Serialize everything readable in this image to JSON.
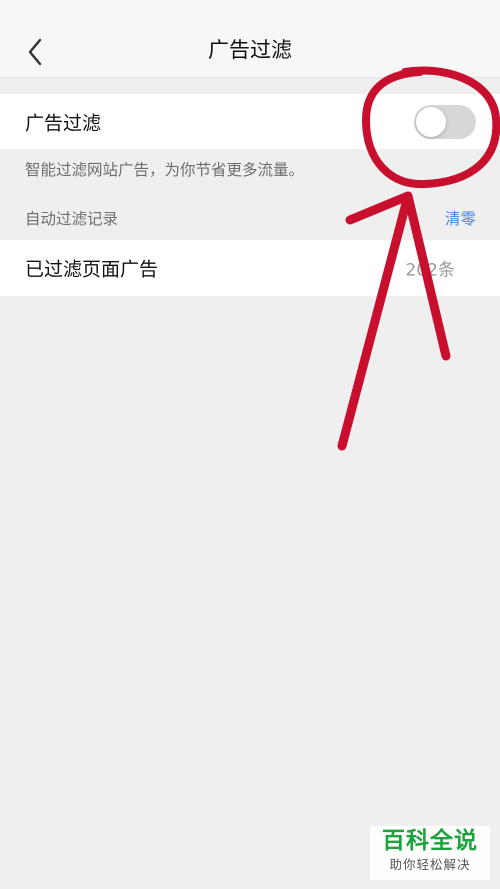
{
  "header": {
    "title": "广告过滤",
    "back_icon": "chevron-left-icon"
  },
  "ad_filter": {
    "label": "广告过滤",
    "toggle_state": "off",
    "description": "智能过滤网站广告，为你节省更多流量。"
  },
  "records": {
    "section_label": "自动过滤记录",
    "clear_label": "清零",
    "row_label": "已过滤页面广告",
    "count_text": "202条"
  },
  "colors": {
    "accent_link": "#3a86e6",
    "annotation_red": "#c8102e",
    "watermark_green": "#1ca33d"
  },
  "watermark": {
    "title": "百科全说",
    "subtitle": "助你轻松解决"
  }
}
